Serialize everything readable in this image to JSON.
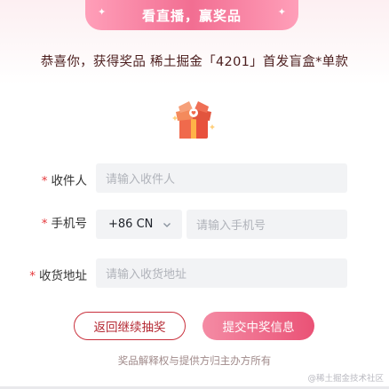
{
  "ribbon": {
    "title": "看直播，赢奖品"
  },
  "prize": {
    "message": "恭喜你，获得奖品 稀土掘金「4201」首发盲盒*单款"
  },
  "form": {
    "required_mark": "*",
    "recipient": {
      "label": "收件人",
      "placeholder": "请输入收件人"
    },
    "phone": {
      "label": "手机号",
      "country_code": "+86 CN",
      "placeholder": "请输入手机号"
    },
    "address": {
      "label": "收货地址",
      "placeholder": "请输入收货地址"
    }
  },
  "actions": {
    "back_label": "返回继续抽奖",
    "submit_label": "提交中奖信息"
  },
  "footnote": "奖品解释权与提供方归主办方所有",
  "watermark": "@稀土掘金技术社区",
  "colors": {
    "accent_pink": "#ea5276",
    "ribbon_pink": "#f26e92",
    "back_border": "#c9303c",
    "required_red": "#e5383b"
  },
  "icons": [
    "gift-box-icon",
    "chevron-down-icon",
    "sparkle-icon"
  ]
}
